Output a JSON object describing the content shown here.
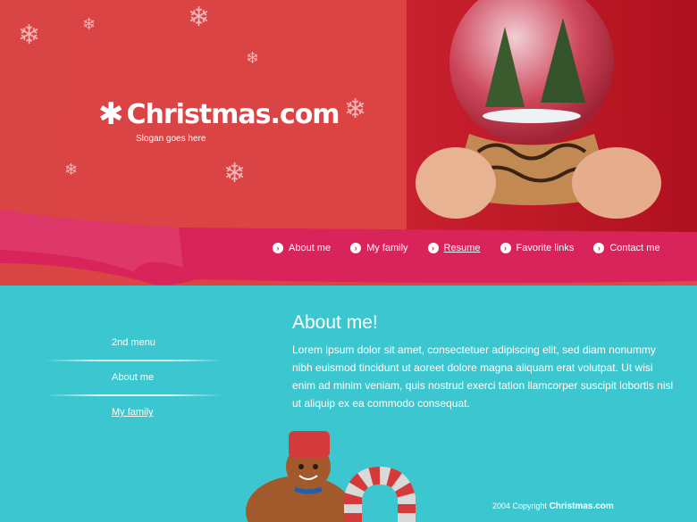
{
  "brand": {
    "name": "Christmas.com",
    "slogan": "Slogan goes here"
  },
  "nav": {
    "items": [
      {
        "label": "About me"
      },
      {
        "label": "My family"
      },
      {
        "label": "Resume"
      },
      {
        "label": "Favorite links"
      },
      {
        "label": "Contact me"
      }
    ],
    "active_index": 2
  },
  "sidebar": {
    "items": [
      {
        "label": "2nd menu"
      },
      {
        "label": "About me"
      },
      {
        "label": "My family"
      }
    ],
    "active_index": 2
  },
  "main": {
    "heading": "About me!",
    "body": "Lorem ipsum dolor sit amet, consectetuer adipiscing elit, sed diam nonummy nibh euismod tincidunt ut aoreet dolore magna aliquam erat volutpat. Ut wisi enim ad minim veniam, quis nostrud exerci tation llamcorper suscipit lobortis nisl ut aliquip ex ea commodo consequat."
  },
  "footer": {
    "copyright": "2004 Copyright",
    "site": "Christmas.com"
  },
  "colors": {
    "header_red": "#d94444",
    "ribbon_pink": "#d8245a",
    "body_teal": "#3cc6cf"
  },
  "icons": [
    "snowflake-icon",
    "asterisk-logo-icon",
    "arrow-right-icon"
  ]
}
